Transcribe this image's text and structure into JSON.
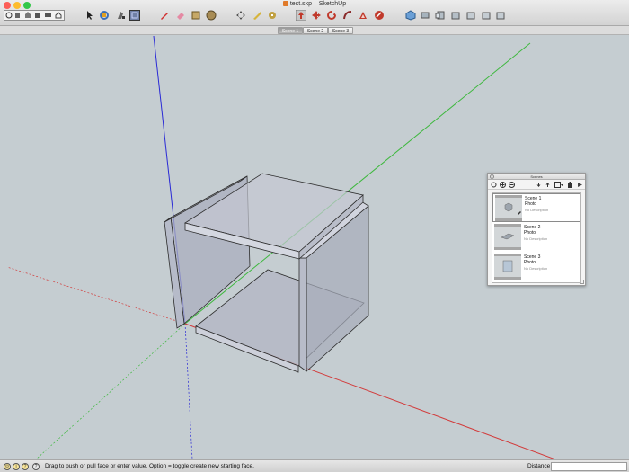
{
  "window": {
    "title": "test.skp – SketchUp",
    "traffic_colors": [
      "#fc5e57",
      "#fdbc2e",
      "#33c748"
    ]
  },
  "toolbar": {
    "left_group": [
      "getting-started-icon",
      "open-file-icon",
      "home-icon",
      "save-icon",
      "print-icon",
      "house-icon"
    ],
    "tools": [
      {
        "name": "select-tool-icon",
        "color": "#222222"
      },
      {
        "name": "orbit-tool-icon",
        "color": "#3b6fb6"
      },
      {
        "name": "paint-bucket-icon",
        "color": "#555555"
      },
      {
        "name": "component-icon",
        "color": "#3a57a0"
      },
      {
        "name": "pencil-icon",
        "color": "#d12f2f"
      },
      {
        "name": "eraser-icon",
        "color": "#e58aa4"
      },
      {
        "name": "rectangle-icon",
        "color": "#b59a5a"
      },
      {
        "name": "circle-icon",
        "color": "#9c8a56"
      },
      {
        "name": "move-icon",
        "color": "#444444"
      },
      {
        "name": "tape-measure-icon",
        "color": "#d6b43b"
      },
      {
        "name": "dimension-icon",
        "color": "#c0a040"
      },
      {
        "name": "push-pull-icon",
        "color": "#c0392b"
      },
      {
        "name": "move-arrows-icon",
        "color": "#c0392b"
      },
      {
        "name": "rotate-icon",
        "color": "#c0392b"
      },
      {
        "name": "follow-me-icon",
        "color": "#8a2a2a"
      },
      {
        "name": "offset-icon",
        "color": "#c0392b"
      },
      {
        "name": "scale-icon",
        "color": "#c0392b"
      }
    ],
    "view_tools": [
      "iso-view-icon",
      "top-view-icon",
      "front-view-icon",
      "right-view-icon",
      "back-view-icon",
      "left-view-icon"
    ]
  },
  "scene_tabs": [
    "Scene 1",
    "Scene 2",
    "Scene 3"
  ],
  "active_scene_tab": "Scene 1",
  "axes_colors": {
    "blue": "#2a2ad6",
    "green": "#3eb83e",
    "red": "#d23b3b"
  },
  "scenes_panel": {
    "title": "Scenes",
    "toolbar_icons": [
      "refresh-icon",
      "add-scene-icon",
      "remove-scene-icon",
      "move-down-icon",
      "move-up-icon",
      "view-options-icon",
      "details-icon",
      "expand-icon"
    ],
    "scenes": [
      {
        "name": "Scene 1",
        "type": "Photo",
        "description": "No Description",
        "selected": true
      },
      {
        "name": "Scene 2",
        "type": "Photo",
        "description": "No Description",
        "selected": false
      },
      {
        "name": "Scene 3",
        "type": "Photo",
        "description": "No Description",
        "selected": false
      }
    ]
  },
  "status": {
    "message": "Drag to push or pull face or enter value.  Option = toggle create new starting face.",
    "distance_label": "Distance",
    "distance_value": ""
  }
}
